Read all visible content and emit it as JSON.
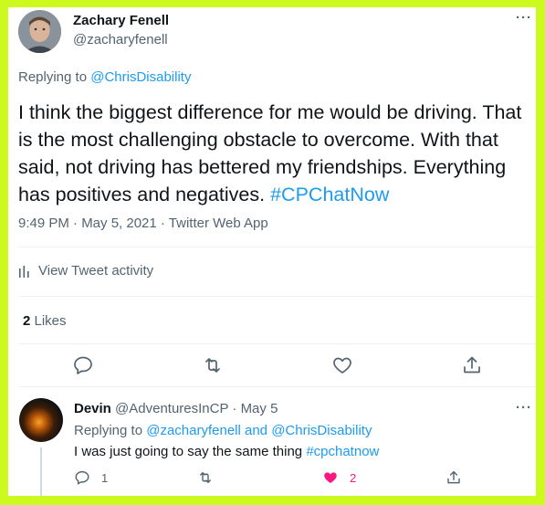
{
  "tweet": {
    "author_name": "Zachary Fenell",
    "author_handle": "@zacharyfenell",
    "more_label": "···",
    "replying_prefix": "Replying to ",
    "replying_to": "@ChrisDisability",
    "text_body": "I think the biggest difference for me would be driving. That is the most challenging obstacle to overcome. With that said, not driving has bettered my friendships. Everything has positives and negatives. ",
    "hashtag": "#CPChatNow",
    "timestamp": "9:49 PM · May 5, 2021 · Twitter Web App",
    "activity_label": "View Tweet activity",
    "likes_count": "2",
    "likes_label": " Likes"
  },
  "reply": {
    "author_name": "Devin",
    "author_handle": "@AdventuresInCP",
    "separator": " · ",
    "date": "May 5",
    "more_label": "···",
    "replying_prefix": "Replying to ",
    "replying_user1": "@zacharyfenell",
    "replying_and": " and ",
    "replying_user2": "@ChrisDisability",
    "text_body": "I was just going to say the same thing ",
    "hashtag": "#cpchatnow",
    "reply_count": "1",
    "like_count": "2"
  },
  "icons": {
    "reply": "reply-icon",
    "retweet": "retweet-icon",
    "like": "heart-icon",
    "share": "share-icon",
    "activity": "bar-chart-icon"
  },
  "colors": {
    "background": "#cdfa1e",
    "link": "#1d9bf0",
    "muted": "#536471",
    "like": "#f91880"
  }
}
